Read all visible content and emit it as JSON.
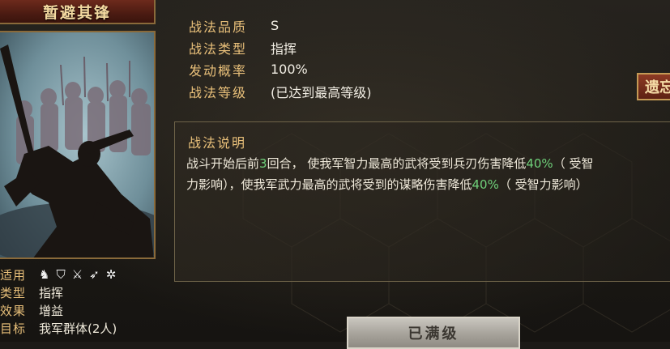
{
  "skill": {
    "name": "暂避其锋",
    "applicable_label": "适用",
    "applicable_icons": [
      "cavalry-icon",
      "shield-icon",
      "crossed-swords-icon",
      "bow-icon",
      "wheel-icon"
    ],
    "type_label": "类型",
    "type_value": "指挥",
    "effect_label": "效果",
    "effect_value": "增益",
    "target_label": "目标",
    "target_value": "我军群体(2人)"
  },
  "stats": [
    {
      "label": "战法品质",
      "value": "S"
    },
    {
      "label": "战法类型",
      "value": "指挥"
    },
    {
      "label": "发动概率",
      "value": "100%"
    },
    {
      "label": "战法等级",
      "value": "(已达到最高等级)"
    }
  ],
  "side_button": {
    "label": "遗忘"
  },
  "description": {
    "heading": "战法说明",
    "line1_a": "战斗开始后前",
    "line1_turns": "3",
    "line1_b": "回合， 使我军智力最高的武将受到兵刃伤害降低",
    "line1_pct": "40%",
    "line1_c": "（ 受智",
    "line2_a": "力影响），使我军武力最高的武将受到的谋略伤害降低",
    "line2_pct": "40%",
    "line2_b": "（ 受智力影响）"
  },
  "max_button": {
    "label": "已满级"
  },
  "colors": {
    "accent": "#e9c07a",
    "highlight": "#6fd07a",
    "title_bg": "#6d2a1c"
  }
}
